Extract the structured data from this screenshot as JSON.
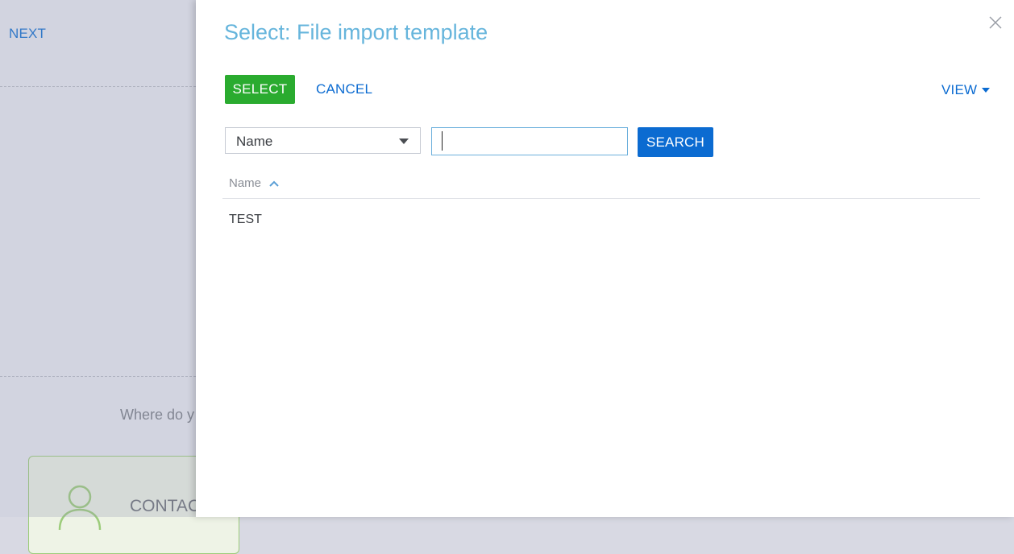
{
  "background": {
    "next_label": "NEXT",
    "question_partial": "Where do y",
    "card_label_partial": "CONTAC"
  },
  "modal": {
    "title": "Select: File import template",
    "select_label": "SELECT",
    "cancel_label": "CANCEL",
    "view_label": "VIEW",
    "filter": {
      "field_selected": "Name",
      "search_value": "",
      "search_label": "SEARCH"
    },
    "grid": {
      "columns": [
        {
          "label": "Name",
          "sort": "ascending"
        }
      ],
      "rows": [
        {
          "name": "TEST"
        }
      ]
    }
  },
  "colors": {
    "select_button": "#2aab2f",
    "primary_blue": "#0b6bd1",
    "title": "#66b5dc"
  },
  "icons": {
    "close": "close-icon",
    "view_dropdown": "chevron-down-icon",
    "sort": "sort-ascending-icon",
    "contact": "person-icon"
  }
}
